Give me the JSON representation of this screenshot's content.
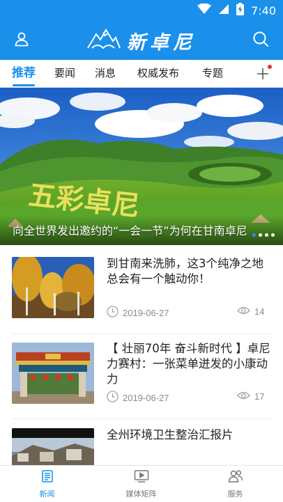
{
  "status_bar": {
    "time": "7:40",
    "icons": [
      "wifi-icon",
      "signal-icon",
      "battery-charging-icon"
    ]
  },
  "header": {
    "logo_text": "新卓尼",
    "left_icon": "user-icon",
    "right_icon": "search-icon",
    "accent_color": "#1a90ea"
  },
  "tabs": [
    {
      "label": "推荐",
      "active": true
    },
    {
      "label": "要闻",
      "active": false
    },
    {
      "label": "消息",
      "active": false
    },
    {
      "label": "权威发布",
      "active": false
    },
    {
      "label": "专题",
      "active": false
    }
  ],
  "add_channel_icon": "plus-icon",
  "banner": {
    "caption": "向全世界发出邀约的“一会一节”为何在甘南卓尼",
    "image_text": "五彩卓尼",
    "slide_count": 4,
    "active_slide": 0
  },
  "news": [
    {
      "title": "到甘南来洗肺，这3个纯净之地总会有一个触动你！",
      "date": "2019-06-27",
      "views": "14",
      "thumb": "autumn-trees-photo"
    },
    {
      "title": "【 壮丽70年 奋斗新时代 】卓尼力赛村：一张菜单迸发的小康动力",
      "date": "2019-06-27",
      "views": "17",
      "thumb": "tibetan-gate-photo"
    },
    {
      "title": "全州环境卫生整治汇报片",
      "date": "",
      "views": "",
      "thumb": "town-street-photo"
    }
  ],
  "bottom_nav": [
    {
      "label": "新闻",
      "icon": "news-icon",
      "active": true
    },
    {
      "label": "媒体矩阵",
      "icon": "media-matrix-icon",
      "active": false
    },
    {
      "label": "服务",
      "icon": "service-icon",
      "active": false
    }
  ]
}
